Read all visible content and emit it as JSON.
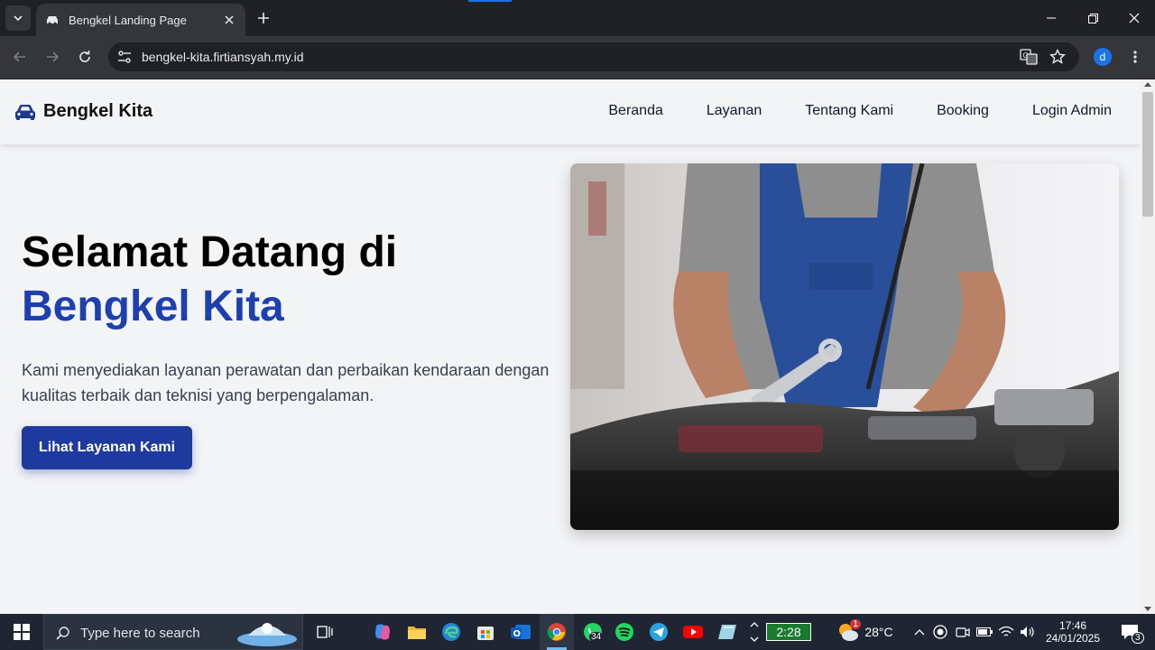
{
  "browser": {
    "tab_title": "Bengkel Landing Page",
    "url": "bengkel-kita.firtiansyah.my.id",
    "profile_initial": "d"
  },
  "site": {
    "brand": "Bengkel Kita",
    "nav": [
      {
        "label": "Beranda"
      },
      {
        "label": "Layanan"
      },
      {
        "label": "Tentang Kami"
      },
      {
        "label": "Booking"
      },
      {
        "label": "Login Admin"
      }
    ],
    "hero": {
      "title_line1": "Selamat Datang di",
      "title_line2": "Bengkel Kita",
      "description": "Kami menyediakan layanan perawatan dan perbaikan kendaraan dengan kualitas terbaik dan teknisi yang berpengalaman.",
      "cta": "Lihat Layanan Kami"
    }
  },
  "taskbar": {
    "search_placeholder": "Type here to search",
    "whatsapp_badge": "34",
    "battery_widget": "2:28",
    "weather_temp": "28°C",
    "weather_badge": "1",
    "time": "17:46",
    "date": "24/01/2025",
    "notification_count": "3"
  },
  "colors": {
    "accent_blue": "#1e40af",
    "cta_bg": "#1e3a9f",
    "page_bg": "#f3f4f6",
    "browser_dark": "#202124",
    "taskbar_bg": "#1f2532"
  }
}
